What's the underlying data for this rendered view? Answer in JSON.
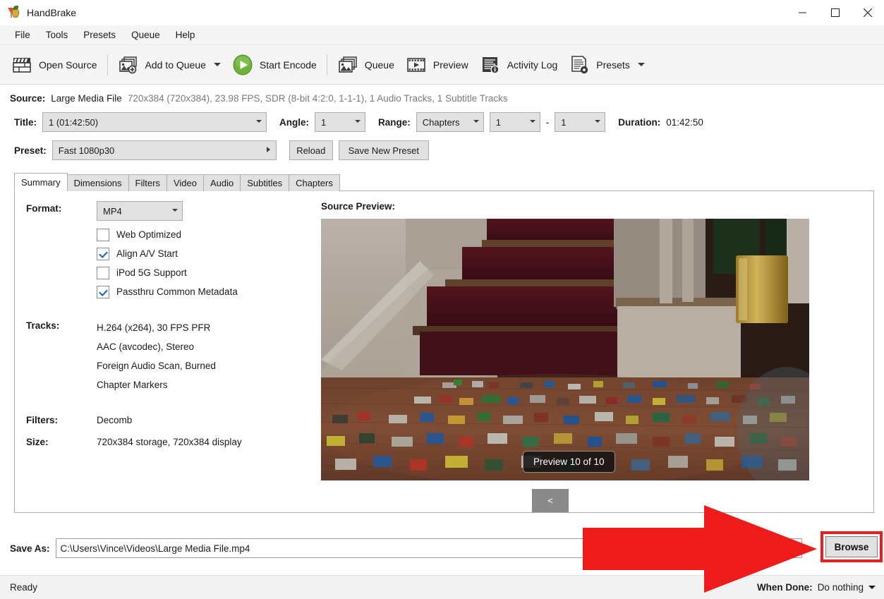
{
  "window": {
    "title": "HandBrake",
    "icon": "handbrake-pineapple-icon",
    "minimize": "minimize-icon",
    "maximize": "maximize-icon",
    "close": "close-icon"
  },
  "menubar": {
    "items": [
      "File",
      "Tools",
      "Presets",
      "Queue",
      "Help"
    ]
  },
  "toolbar": {
    "items": [
      {
        "label": "Open Source",
        "icon": "film-slate-icon"
      },
      {
        "label": "Add to Queue",
        "icon": "add-image-icon",
        "has_caret": true
      },
      {
        "label": "Start Encode",
        "icon": "green-play-icon"
      },
      {
        "label": "Queue",
        "icon": "queue-stack-icon"
      },
      {
        "label": "Preview",
        "icon": "film-strip-play-icon"
      },
      {
        "label": "Activity Log",
        "icon": "log-info-icon"
      },
      {
        "label": "Presets",
        "icon": "preset-gear-icon",
        "has_caret": true
      }
    ]
  },
  "source": {
    "label": "Source:",
    "name": "Large Media File",
    "meta": "720x384 (720x384), 23.98 FPS, SDR (8-bit 4:2:0, 1-1-1), 1 Audio Tracks, 1 Subtitle Tracks"
  },
  "title_row": {
    "title_label": "Title:",
    "title_value": "1 (01:42:50)",
    "angle_label": "Angle:",
    "angle_value": "1",
    "range_label": "Range:",
    "range_value": "Chapters",
    "range_start": "1",
    "range_dash": "-",
    "range_end": "1",
    "duration_label": "Duration:",
    "duration_value": "01:42:50"
  },
  "preset_row": {
    "label": "Preset:",
    "value": "Fast 1080p30",
    "reload": "Reload",
    "save_new_preset": "Save New Preset"
  },
  "tabs": [
    {
      "label": "Summary",
      "active": true
    },
    {
      "label": "Dimensions",
      "active": false
    },
    {
      "label": "Filters",
      "active": false
    },
    {
      "label": "Video",
      "active": false
    },
    {
      "label": "Audio",
      "active": false
    },
    {
      "label": "Subtitles",
      "active": false
    },
    {
      "label": "Chapters",
      "active": false
    }
  ],
  "summary": {
    "format_label": "Format:",
    "format_value": "MP4",
    "checkboxes": [
      {
        "label": "Web Optimized",
        "checked": false
      },
      {
        "label": "Align A/V Start",
        "checked": true
      },
      {
        "label": "iPod 5G Support",
        "checked": false
      },
      {
        "label": "Passthru Common Metadata",
        "checked": true
      }
    ],
    "tracks_label": "Tracks:",
    "tracks": [
      "H.264 (x264), 30 FPS PFR",
      "AAC (avcodec), Stereo",
      "Foreign Audio Scan, Burned",
      "Chapter Markers"
    ],
    "filters_label": "Filters:",
    "filters_value": "Decomb",
    "size_label": "Size:",
    "size_value": "720x384 storage, 720x384 display"
  },
  "preview": {
    "title": "Source Preview:",
    "counter": "Preview 10 of 10",
    "prev_button": "<"
  },
  "save_as": {
    "label": "Save As:",
    "path": "C:\\Users\\Vince\\Videos\\Large Media File.mp4",
    "browse": "Browse"
  },
  "statusbar": {
    "status": "Ready",
    "when_done_label": "When Done:",
    "when_done_value": "Do nothing"
  },
  "annotation": {
    "arrow": "red-right-arrow",
    "highlight": "red-highlight-box",
    "color": "#ee1b1b"
  }
}
